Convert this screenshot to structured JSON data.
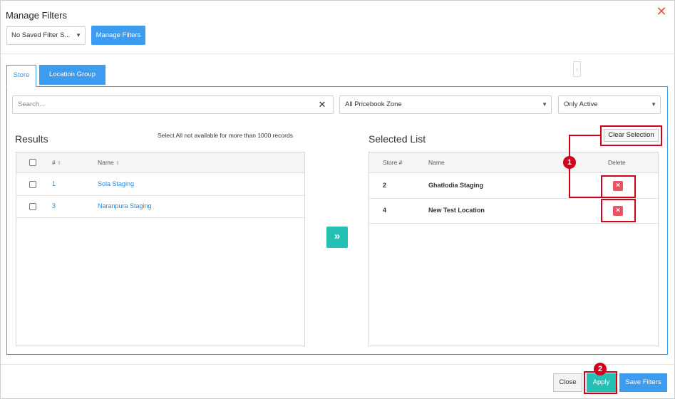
{
  "dialog": {
    "title": "Manage Filters",
    "saved_filter_select": "No Saved Filter S...",
    "manage_filters_button": "Manage Filters"
  },
  "tabs": [
    {
      "label": "Store",
      "active": true
    },
    {
      "label": "Location Group",
      "active": false
    }
  ],
  "filters": {
    "search_placeholder": "Search...",
    "zone_select": "All Pricebook Zone",
    "status_select": "Only Active"
  },
  "results": {
    "title": "Results",
    "note": "Select All not available for more than 1000 records",
    "columns": {
      "number": "#",
      "name": "Name"
    },
    "rows": [
      {
        "number": "1",
        "name": "Sola Staging"
      },
      {
        "number": "3",
        "name": "Naranpura Staging"
      }
    ]
  },
  "selected": {
    "title": "Selected List",
    "clear_button": "Clear Selection",
    "columns": {
      "store": "Store #",
      "name": "Name",
      "delete": "Delete"
    },
    "rows": [
      {
        "store": "2",
        "name": "Ghatlodia Staging"
      },
      {
        "store": "4",
        "name": "New Test Location"
      }
    ]
  },
  "footer": {
    "close_button": "Close",
    "apply_button": "Apply",
    "save_button": "Save Filters"
  },
  "annotations": {
    "badge_1": "1",
    "badge_2": "2"
  },
  "colors": {
    "primary": "#3d9cf0",
    "teal": "#24c0b3",
    "delete": "#e85462",
    "annotation": "#d0021b"
  }
}
